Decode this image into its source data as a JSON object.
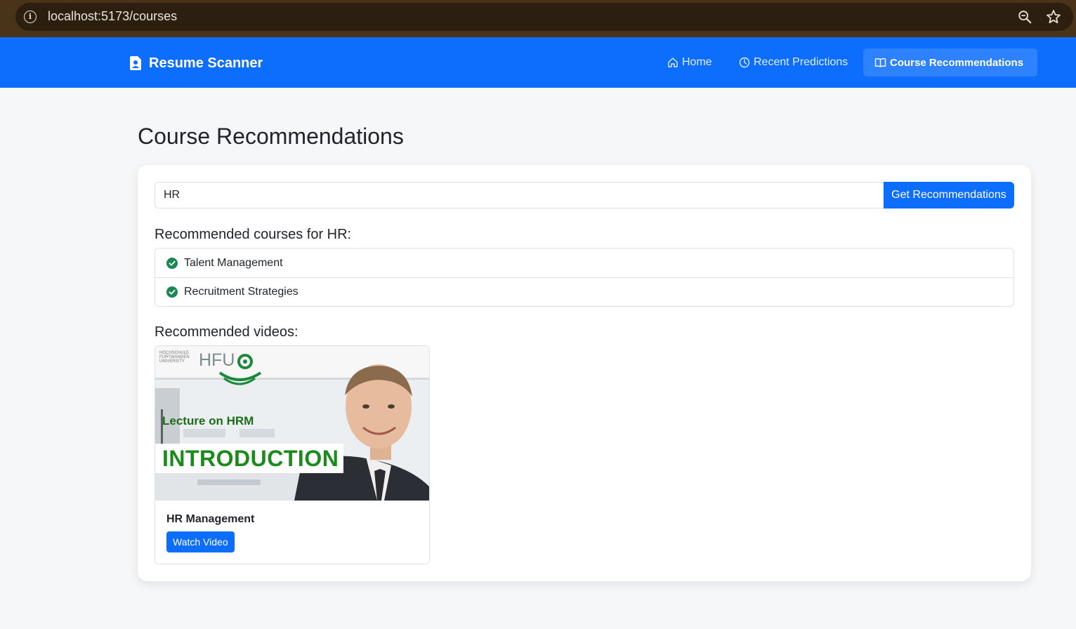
{
  "browser": {
    "url": "localhost:5173/courses"
  },
  "navbar": {
    "brand": "Resume Scanner",
    "items": [
      {
        "label": "Home",
        "icon": "home-icon"
      },
      {
        "label": "Recent Predictions",
        "icon": "clock-icon"
      },
      {
        "label": "Course Recommendations",
        "icon": "book-icon",
        "active": true
      }
    ]
  },
  "page": {
    "title": "Course Recommendations"
  },
  "search": {
    "value": "HR",
    "button_label": "Get Recommendations"
  },
  "courses": {
    "heading": "Recommended courses for HR:",
    "items": [
      {
        "label": "Talent Management",
        "icon": "check-circle-icon"
      },
      {
        "label": "Recruitment Strategies",
        "icon": "check-circle-icon"
      }
    ]
  },
  "videos": {
    "heading": "Recommended videos:",
    "items": [
      {
        "title": "HR Management",
        "button_label": "Watch Video",
        "thumbnail": {
          "school": "HOCHSCHULE FURTWANGEN UNIVERSITY",
          "logo": "HFU",
          "caption": "Lecture on HRM",
          "headline": "INTRODUCTION"
        }
      }
    ]
  },
  "colors": {
    "primary": "#0d6efd",
    "success": "#198754",
    "chrome": "#4a3419",
    "page_bg": "#f6f7f9"
  }
}
